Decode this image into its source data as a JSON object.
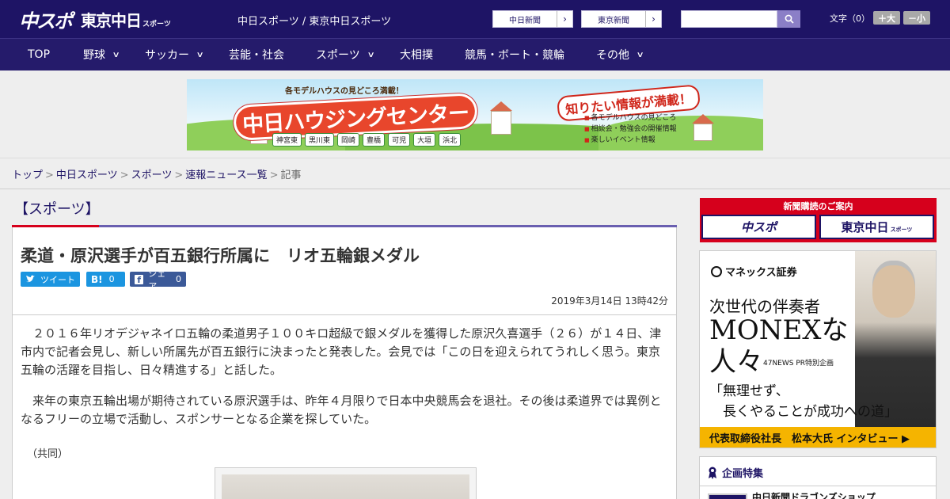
{
  "header": {
    "logo_main": "中スポ",
    "logo_sub": "東京中日",
    "logo_sub_small": "スポーツ",
    "site_links": "中日スポーツ / 東京中日スポーツ",
    "paper_buttons": [
      "中日新聞",
      "東京新聞"
    ],
    "search_placeholder": "",
    "fontsize_label": "文字（0）",
    "font_larger": "＋大",
    "font_smaller": "－小"
  },
  "nav": {
    "items": [
      {
        "label": "TOP",
        "has_menu": false
      },
      {
        "label": "野球",
        "has_menu": true
      },
      {
        "label": "サッカー",
        "has_menu": true
      },
      {
        "label": "芸能・社会",
        "has_menu": false
      },
      {
        "label": "スポーツ",
        "has_menu": true
      },
      {
        "label": "大相撲",
        "has_menu": false
      },
      {
        "label": "競馬・ボート・競輪",
        "has_menu": false
      },
      {
        "label": "その他",
        "has_menu": true
      }
    ],
    "chevron": "∨"
  },
  "ad_banner": {
    "top_text": "各モデルハウスの見どころ満載！",
    "title": "中日ハウジングセンター",
    "catch": "知りたい情報が満載！",
    "cities": [
      "神宮東",
      "黒川東",
      "岡崎",
      "豊橋",
      "可児",
      "大垣",
      "浜北"
    ],
    "bullets": [
      "各モデルハウスの見どころ",
      "相談会・勉強会の開催情報",
      "楽しいイベント情報"
    ]
  },
  "breadcrumb": {
    "items": [
      "トップ",
      "中日スポーツ",
      "スポーツ",
      "速報ニュース一覧"
    ],
    "current": "記事",
    "separator": ">"
  },
  "article": {
    "category": "【スポーツ】",
    "headline": "柔道・原沢選手が百五銀行所属に　リオ五輪銀メダル",
    "share": {
      "tweet": "ツイート",
      "hatena": "B!",
      "hatena_count": "0",
      "facebook": "シェア",
      "facebook_count": "0"
    },
    "date": "2019年3月14日 13時42分",
    "paragraphs": [
      "２０１６年リオデジャネイロ五輪の柔道男子１００キロ超級で銀メダルを獲得した原沢久喜選手（２６）が１４日、津市内で記者会見し、新しい所属先が百五銀行に決まったと発表した。会見では「この日を迎えられてうれしく思う。東京五輪の活躍を目指し、日々精進する」と話した。",
      "来年の東京五輪出場が期待されている原沢選手は、昨年４月限りで日本中央競馬会を退社。その後は柔道界では異例となるフリーの立場で活動し、スポンサーとなる企業を探していた。"
    ],
    "credit": "（共同）"
  },
  "sidebar": {
    "subscribe_title": "新聞購読のご案内",
    "subscribe_buttons": [
      "中スポ",
      "東京中日"
    ],
    "subscribe_small": "スポーツ",
    "monex": {
      "brand": "マネックス証券",
      "heading1": "次世代の伴奏者",
      "heading2a": "MONEXな",
      "heading2b": "人々",
      "pr": "47NEWS PR特別企画",
      "quote1": "「無理せず、",
      "quote2": "　長くやることが成功への道」",
      "footer": "代表取締役社長　松本大氏 インタビュー ▶"
    },
    "feature_title": "企画特集",
    "feature_item": "中日新聞ドラゴンズショップ"
  },
  "colors": {
    "brand_navy": "#1e1465",
    "accent_red": "#d6001c",
    "twitter_blue": "#1b95e0",
    "monex_yellow": "#f5b400"
  }
}
